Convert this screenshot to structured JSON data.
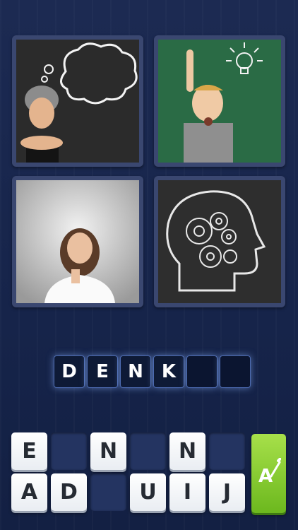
{
  "puzzle": {
    "images": [
      {
        "name": "Denkende vrouw met denkwolk"
      },
      {
        "name": "Jongen met idee-lamp"
      },
      {
        "name": "Vrouw denkt na"
      },
      {
        "name": "Hoofd met tandwielen"
      }
    ]
  },
  "answer": {
    "slots": [
      "D",
      "E",
      "N",
      "K",
      "",
      ""
    ]
  },
  "letter_pool": {
    "row1": [
      "E",
      "",
      "N",
      "",
      "N",
      ""
    ],
    "row2": [
      "A",
      "D",
      "",
      "U",
      "I",
      "J"
    ]
  },
  "hint_button": {
    "label": "A"
  },
  "colors": {
    "background": "#16244a",
    "tile_frame": "#3a4770",
    "answer_glow": "#8cb4ff",
    "hint_green": "#8ccd33"
  }
}
